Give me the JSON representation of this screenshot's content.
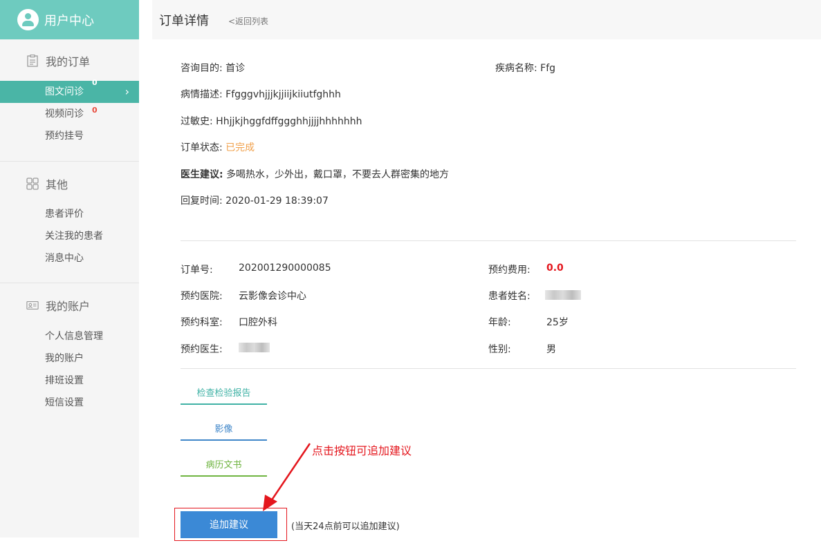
{
  "sidebar": {
    "header_title": "用户中心",
    "groups": [
      {
        "title": "我的订单",
        "items": [
          {
            "label": "图文问诊",
            "badge": "0"
          },
          {
            "label": "视频问诊",
            "badge": "0"
          },
          {
            "label": "预约挂号"
          }
        ]
      },
      {
        "title": "其他",
        "items": [
          {
            "label": "患者评价"
          },
          {
            "label": "关注我的患者"
          },
          {
            "label": "消息中心"
          }
        ]
      },
      {
        "title": "我的账户",
        "items": [
          {
            "label": "个人信息管理"
          },
          {
            "label": "我的账户"
          },
          {
            "label": "排班设置"
          },
          {
            "label": "短信设置"
          }
        ]
      }
    ]
  },
  "header": {
    "title": "订单详情",
    "back_link": "<返回列表"
  },
  "consult": {
    "purpose_label": "咨询目的:",
    "purpose_value": "首诊",
    "disease_label": "疾病名称:",
    "disease_value": "Ffg",
    "desc_label": "病情描述:",
    "desc_value": "Ffgggvhjjjkjjiijkiiutfghhh",
    "allergy_label": "过敏史:",
    "allergy_value": "Hhjjkjhggfdffggghhjjjjhhhhhhh",
    "status_label": "订单状态:",
    "status_value": "已完成",
    "advice_label": "医生建议:",
    "advice_value": "多喝热水，少外出，戴口罩，不要去人群密集的地方",
    "reply_label": "回复时间:",
    "reply_value": "2020-01-29 18:39:07"
  },
  "order": {
    "order_no_label": "订单号:",
    "order_no_value": "202001290000085",
    "fee_label": "预约费用:",
    "fee_value": "0.0",
    "hospital_label": "预约医院:",
    "hospital_value": "云影像会诊中心",
    "patient_label": "患者姓名:",
    "dept_label": "预约科室:",
    "dept_value": "口腔外科",
    "age_label": "年龄:",
    "age_value": "25岁",
    "doctor_label": "预约医生:",
    "gender_label": "性别:",
    "gender_value": "男"
  },
  "tabs": [
    "检查检验报告",
    "影像",
    "病历文书"
  ],
  "actions": {
    "add_advice": "追加建议",
    "hint": "(当天24点前可以追加建议)",
    "annotation": "点击按钮可追加建议"
  },
  "colors": {
    "accent": "#6ecbbf",
    "active": "#4ab5a6",
    "button": "#3b89d6",
    "annotation": "#e4161d",
    "status": "#f0a04b"
  }
}
